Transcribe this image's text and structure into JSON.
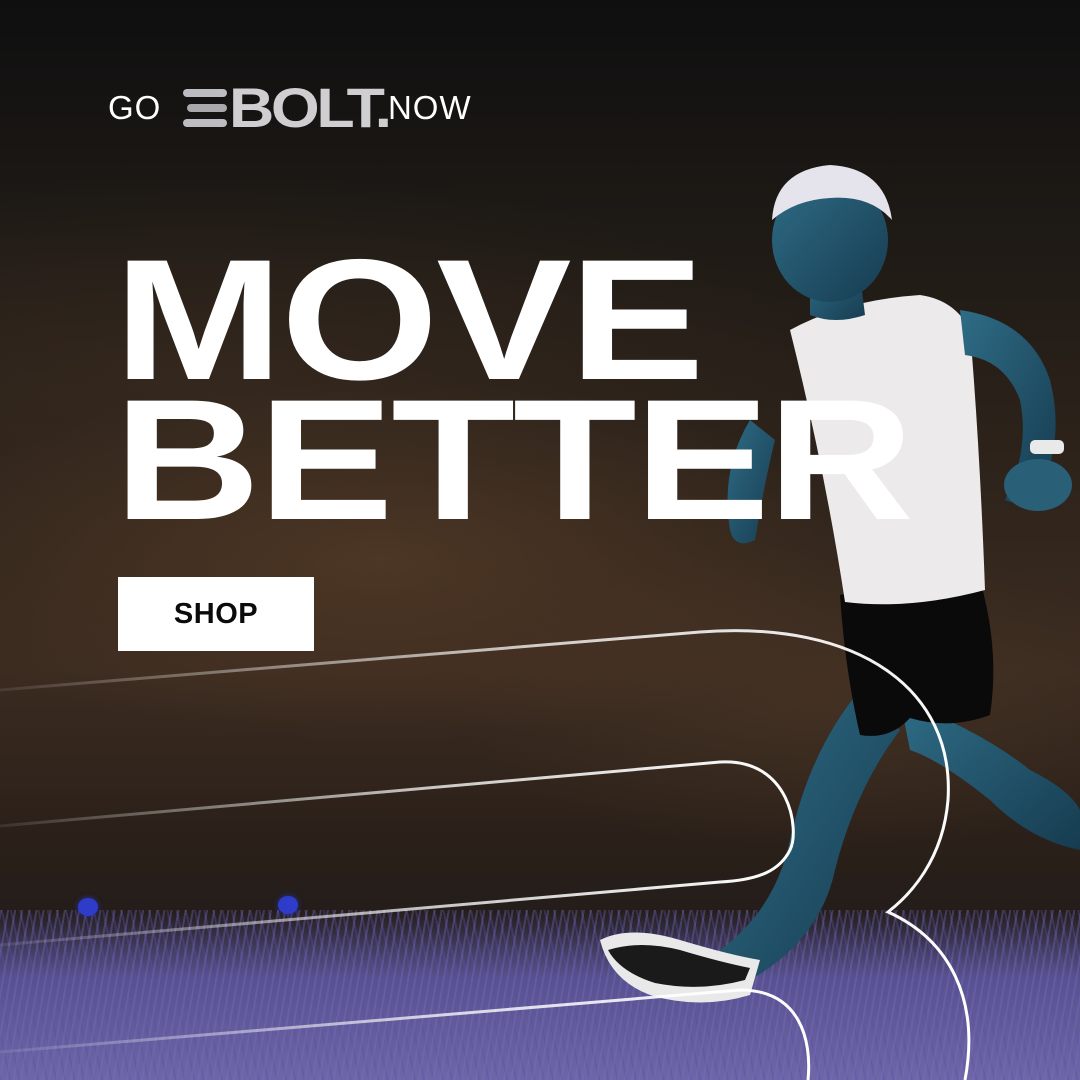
{
  "banner": {
    "tagline_prefix": "GO",
    "brand": "BOLT.",
    "tagline_suffix": "NOW",
    "headline_line1": "MOVE",
    "headline_line2": "BETTER",
    "cta_label": "SHOP"
  },
  "colors": {
    "text": "#ffffff",
    "button_bg": "#ffffff",
    "button_text": "#0b0b0b",
    "logo": "#cfcfd2",
    "background_top": "#0f0f10",
    "background_mid": "#3b2b20",
    "grass": "#6d67a8"
  }
}
